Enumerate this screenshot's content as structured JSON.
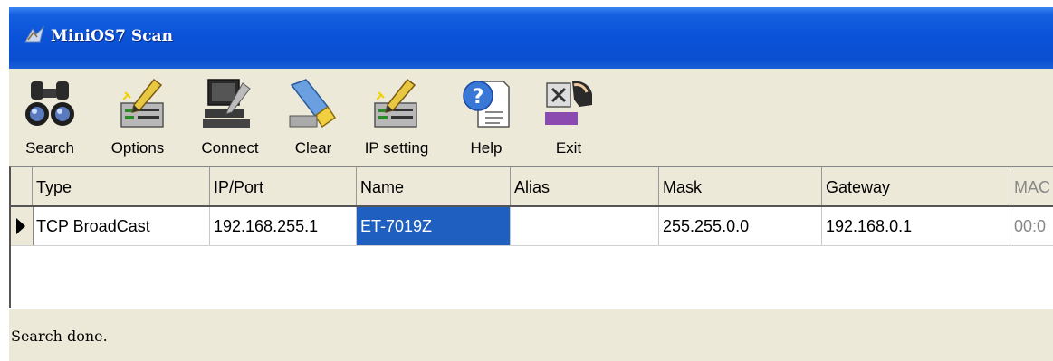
{
  "window": {
    "title": "MiniOS7 Scan"
  },
  "toolbar": {
    "buttons": [
      {
        "label": "Search",
        "icon": "binoculars-icon"
      },
      {
        "label": "Options",
        "icon": "options-pencil-icon"
      },
      {
        "label": "Connect",
        "icon": "computer-connect-icon"
      },
      {
        "label": "Clear",
        "icon": "eraser-icon"
      },
      {
        "label": "IP setting",
        "icon": "ip-setting-pencil-icon"
      },
      {
        "label": "Help",
        "icon": "help-document-icon"
      },
      {
        "label": "Exit",
        "icon": "exit-hand-icon"
      }
    ]
  },
  "grid": {
    "headers": [
      "Type",
      "IP/Port",
      "Name",
      "Alias",
      "Mask",
      "Gateway",
      "MAC"
    ],
    "rows": [
      {
        "type": "TCP BroadCast",
        "ip": "192.168.255.1",
        "name": "ET-7019Z",
        "alias": "",
        "mask": "255.255.0.0",
        "gateway": "192.168.0.1",
        "mac": "00:0"
      }
    ]
  },
  "status": {
    "text": "Search done."
  },
  "colors": {
    "titlebar": "#0a52d8",
    "selection": "#1f5fbf",
    "chrome": "#ece9d8"
  }
}
